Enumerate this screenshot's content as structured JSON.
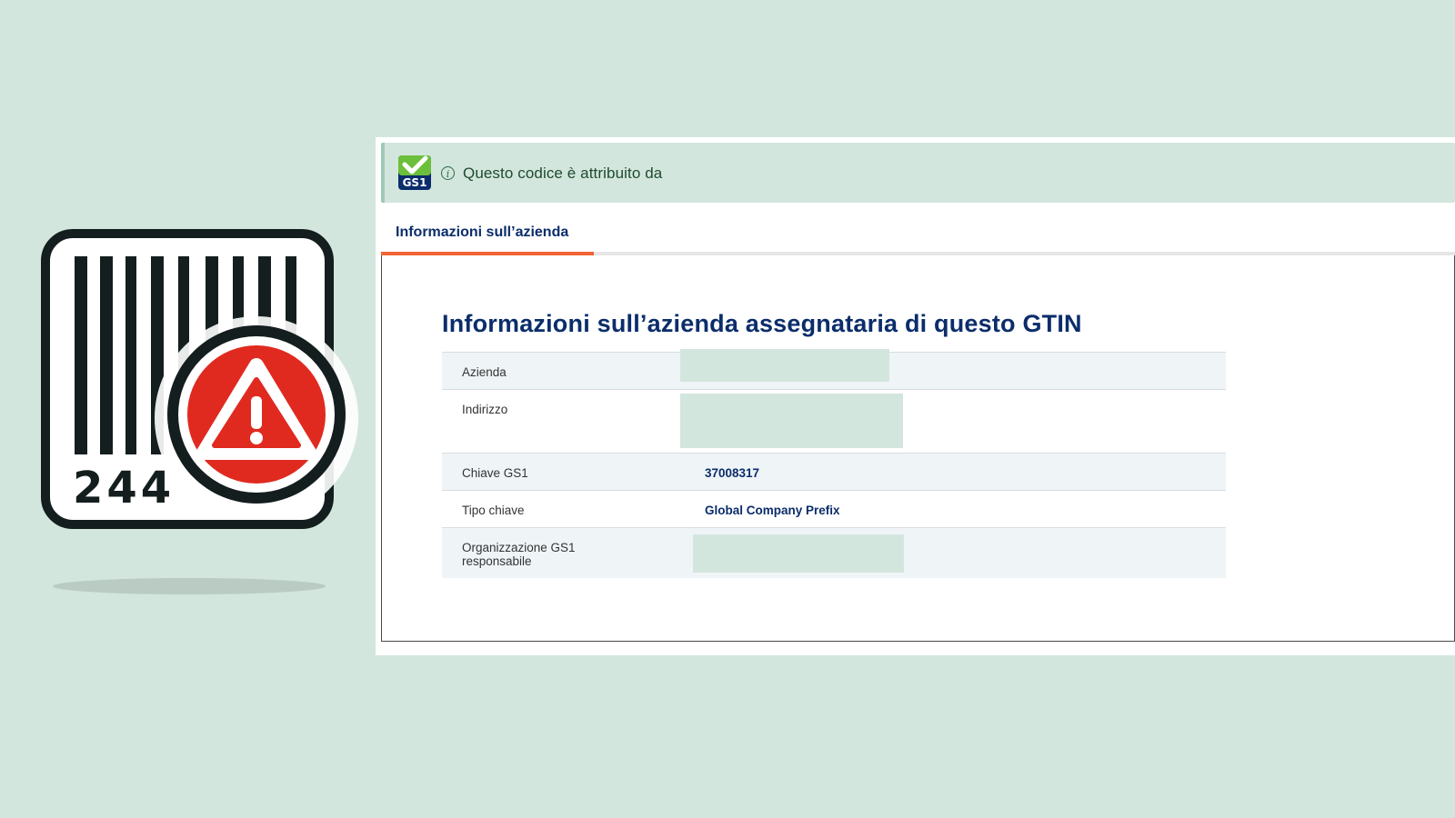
{
  "illustration": {
    "barcode_number": "244",
    "warning_icon": "warning-triangle-icon"
  },
  "banner": {
    "logo_text": "GS1",
    "text": "Questo codice è attribuito da",
    "info_icon": "i"
  },
  "tabs": [
    {
      "label": "Informazioni sull’azienda",
      "active": true
    }
  ],
  "content": {
    "title": "Informazioni sull’azienda assegnataria di questo GTIN",
    "rows": [
      {
        "label": "Azienda",
        "value": "",
        "redacted": true
      },
      {
        "label": "Indirizzo",
        "value": "",
        "redacted": true
      },
      {
        "label": "Chiave GS1",
        "value": "37008317",
        "redacted": false
      },
      {
        "label": "Tipo chiave",
        "value": "Global Company Prefix",
        "redacted": false
      },
      {
        "label": "Organizzazione GS1 responsabile",
        "value": "",
        "redacted": true
      }
    ]
  },
  "colors": {
    "background": "#d3e6dd",
    "brand_navy": "#0b2d6b",
    "tab_accent": "#f26335",
    "gs1_green": "#6cbf3b",
    "warning_red": "#e02a20"
  }
}
